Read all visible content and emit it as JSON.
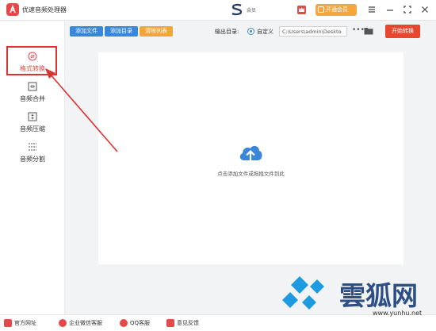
{
  "app": {
    "title": "优速音频处理器",
    "user_name": "会员"
  },
  "titlebar": {
    "vip_label": "开通会员"
  },
  "sidebar": {
    "items": [
      {
        "label": "格式转换",
        "icon": "format-convert-icon",
        "active": true
      },
      {
        "label": "音频合并",
        "icon": "audio-merge-icon",
        "active": false
      },
      {
        "label": "音频压缩",
        "icon": "audio-compress-icon",
        "active": false
      },
      {
        "label": "音频分割",
        "icon": "audio-split-icon",
        "active": false
      }
    ]
  },
  "toolbar": {
    "add_file": "添加文件",
    "add_folder": "添加目录",
    "clear_list": "清除列表",
    "output_dir_label": "输出目录:",
    "custom_option": "自定义",
    "output_path": "C:\\Users\\admin\\Deskto",
    "more": "•••",
    "start_button": "开始转换"
  },
  "main": {
    "drop_hint": "点击添加文件或拖拽文件到此"
  },
  "footer": {
    "items": [
      {
        "label": "官方网址",
        "icon": "website-icon"
      },
      {
        "label": "企业微信客服",
        "icon": "wechat-service-icon"
      },
      {
        "label": "QQ客服",
        "icon": "qq-icon"
      },
      {
        "label": "意见反馈",
        "icon": "feedback-icon"
      }
    ]
  },
  "watermark": {
    "name": "雲狐网",
    "url": "www.yunhu.net"
  },
  "colors": {
    "accent_red": "#e8474a",
    "toolbar_blue": "#3a86d8",
    "clear_orange": "#f0a73a",
    "vip_orange": "#f6a63c",
    "watermark_blue": "#2c4f86"
  }
}
